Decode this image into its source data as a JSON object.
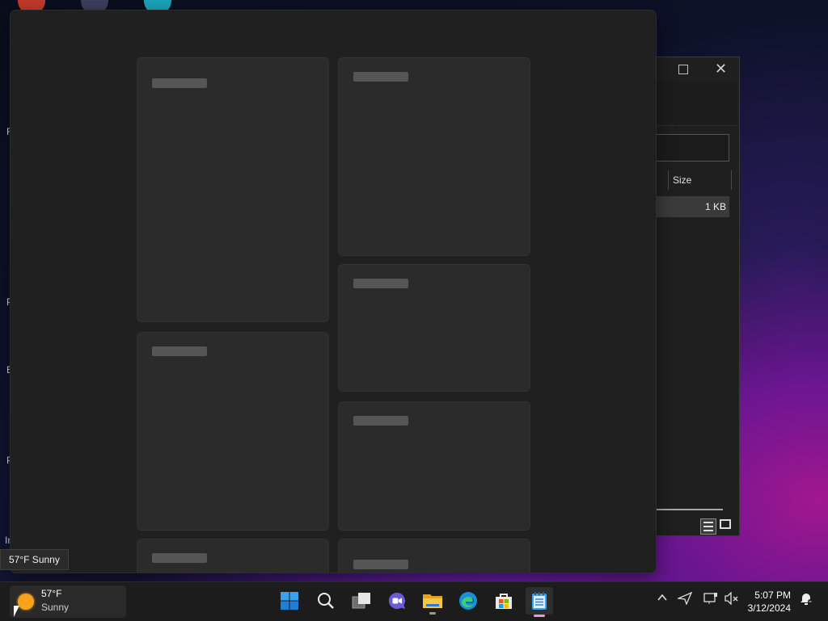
{
  "desktop": {
    "side_letters": [
      "F",
      "P",
      "E",
      "P",
      "In"
    ]
  },
  "explorer": {
    "size_header": "Size",
    "row_size": "1 KB"
  },
  "tooltip": {
    "text": "57°F Sunny"
  },
  "taskbar": {
    "weather": {
      "temp": "57°F",
      "condition": "Sunny"
    },
    "apps": [
      "start",
      "search",
      "task-view",
      "teams-chat",
      "file-explorer",
      "edge",
      "store",
      "notepad"
    ],
    "clock": {
      "time": "5:07 PM",
      "date": "3/12/2024"
    }
  },
  "colors": {
    "accent": "#0078d4",
    "sun": "#f7a21b"
  }
}
